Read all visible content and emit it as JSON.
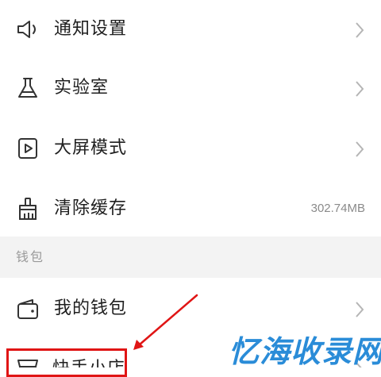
{
  "settings": {
    "items": [
      {
        "label": "通知设置",
        "icon": "speaker-icon"
      },
      {
        "label": "实验室",
        "icon": "flask-icon"
      },
      {
        "label": "大屏模式",
        "icon": "play-screen-icon"
      },
      {
        "label": "清除缓存",
        "icon": "broom-icon",
        "value": "302.74MB"
      }
    ]
  },
  "wallet_section": {
    "title": "钱包",
    "items": [
      {
        "label": "我的钱包",
        "icon": "wallet-icon"
      },
      {
        "label": "快手小店",
        "icon": "shop-icon"
      }
    ]
  },
  "watermark": {
    "text": "忆海收录网"
  },
  "colors": {
    "highlight": "#e01515",
    "watermark": "#2a8cd8",
    "section_background": "#f3f3f3",
    "meta_text": "#8a8a8a"
  }
}
